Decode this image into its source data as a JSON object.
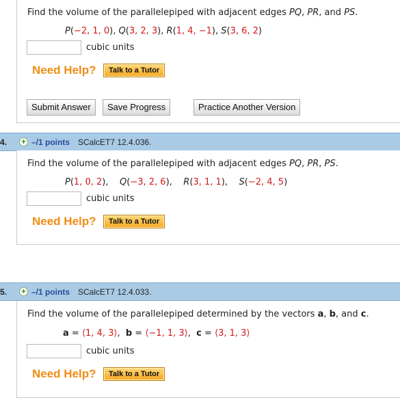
{
  "q3": {
    "text": "Find the volume of the parallelepiped with adjacent edges PQ, PR, and PS.",
    "points": [
      "P(",
      "−2, 1, 0",
      "), Q(",
      "3, 2, 3",
      "), R(",
      "1, 4, −1",
      "), S(",
      "3, 6, 2",
      ")"
    ],
    "units": "cubic units",
    "need_help": "Need Help?",
    "tutor": "Talk to a Tutor",
    "submit": "Submit Answer",
    "save": "Save Progress",
    "practice": "Practice Another Version"
  },
  "q4": {
    "number": "4.",
    "points_label": "–/1 points",
    "source": "SCalcET7 12.4.036.",
    "text": "Find the volume of the parallelepiped with adjacent edges PQ, PR, PS.",
    "P": "P(",
    "Pv": "1, 0, 2",
    "Pc": "),",
    "Q": "Q(",
    "Qv": "−3, 2, 6",
    "Qc": "),",
    "R": "R(",
    "Rv": "3, 1, 1",
    "Rc": "),",
    "S": "S(",
    "Sv": "−2, 4, 5",
    "Sc": ")",
    "units": "cubic units",
    "need_help": "Need Help?",
    "tutor": "Talk to a Tutor"
  },
  "q5": {
    "number": "5.",
    "points_label": "–/1 points",
    "source": "SCalcET7 12.4.033.",
    "text_pre": "Find the volume of the parallelepiped determined by the vectors ",
    "a": "a",
    "comma1": ", ",
    "b": "b",
    "and": ", and ",
    "c": "c",
    "dot": ".",
    "a_label": "a",
    "a_eq": " = ",
    "a_val": "⟨1, 4, 3⟩",
    "b_label": "b",
    "b_eq": " = ",
    "b_val": "⟨−1, 1, 3⟩",
    "c_label": "c",
    "c_eq": " = ",
    "c_val": "⟨3, 1, 3⟩",
    "sep": ",",
    "units": "cubic units",
    "need_help": "Need Help?",
    "tutor": "Talk to a Tutor"
  }
}
